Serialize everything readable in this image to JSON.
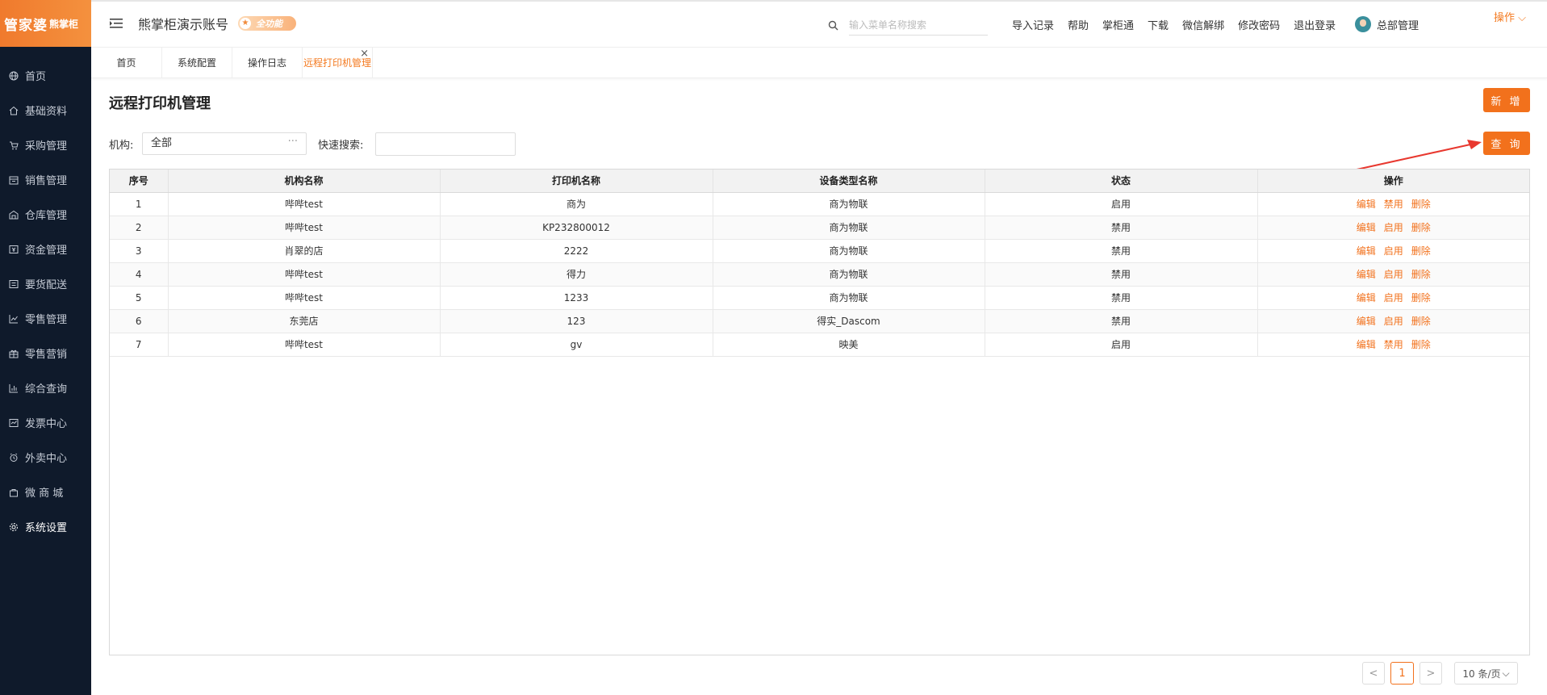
{
  "brand": {
    "logo_main": "管家婆",
    "logo_sub": "熊掌柜"
  },
  "header": {
    "account_name": "熊掌柜演示账号",
    "edition_badge": "全功能",
    "search_placeholder": "输入菜单名称搜索",
    "links": [
      "导入记录",
      "帮助",
      "掌柜通",
      "下载",
      "微信解绑",
      "修改密码",
      "退出登录"
    ],
    "user_name": "总部管理"
  },
  "sidebar": {
    "items": [
      {
        "label": "首页",
        "icon": "globe-icon"
      },
      {
        "label": "基础资料",
        "icon": "home-icon"
      },
      {
        "label": "采购管理",
        "icon": "cart-icon"
      },
      {
        "label": "销售管理",
        "icon": "calendar-icon"
      },
      {
        "label": "仓库管理",
        "icon": "warehouse-icon"
      },
      {
        "label": "资金管理",
        "icon": "money-icon"
      },
      {
        "label": "要货配送",
        "icon": "list-icon"
      },
      {
        "label": "零售管理",
        "icon": "bar-chart-icon"
      },
      {
        "label": "零售营销",
        "icon": "gift-icon"
      },
      {
        "label": "综合查询",
        "icon": "stats-icon"
      },
      {
        "label": "发票中心",
        "icon": "invoice-icon"
      },
      {
        "label": "外卖中心",
        "icon": "alarm-icon"
      },
      {
        "label": "微 商 城",
        "icon": "bag-icon"
      },
      {
        "label": "系统设置",
        "icon": "gear-icon"
      }
    ],
    "active_index": 13
  },
  "tabs": {
    "items": [
      "首页",
      "系统配置",
      "操作日志",
      "远程打印机管理"
    ],
    "active_index": 3,
    "actions_label": "操作"
  },
  "page": {
    "title": "远程打印机管理",
    "new_button": "新 增",
    "query_button": "查 询",
    "org_label": "机构:",
    "org_value": "全部",
    "quick_search_label": "快速搜索:"
  },
  "table": {
    "headers": [
      "序号",
      "机构名称",
      "打印机名称",
      "设备类型名称",
      "状态",
      "操作"
    ],
    "rows": [
      {
        "no": "1",
        "org": "哔哔test",
        "printer": "商为",
        "type": "商为物联",
        "status": "启用",
        "toggle": "禁用"
      },
      {
        "no": "2",
        "org": "哔哔test",
        "printer": "KP232800012",
        "type": "商为物联",
        "status": "禁用",
        "toggle": "启用"
      },
      {
        "no": "3",
        "org": "肖翠的店",
        "printer": "2222",
        "type": "商为物联",
        "status": "禁用",
        "toggle": "启用"
      },
      {
        "no": "4",
        "org": "哔哔test",
        "printer": "得力",
        "type": "商为物联",
        "status": "禁用",
        "toggle": "启用"
      },
      {
        "no": "5",
        "org": "哔哔test",
        "printer": "1233",
        "type": "商为物联",
        "status": "禁用",
        "toggle": "启用"
      },
      {
        "no": "6",
        "org": "东莞店",
        "printer": "123",
        "type": "得实_Dascom",
        "status": "禁用",
        "toggle": "启用"
      },
      {
        "no": "7",
        "org": "哔哔test",
        "printer": "gv",
        "type": "映美",
        "status": "启用",
        "toggle": "禁用"
      }
    ],
    "edit_label": "编辑",
    "delete_label": "删除"
  },
  "pagination": {
    "current": "1",
    "page_size": "10 条/页"
  },
  "colors": {
    "accent": "#f2711c",
    "sidebar_bg": "#0f1a2b"
  }
}
